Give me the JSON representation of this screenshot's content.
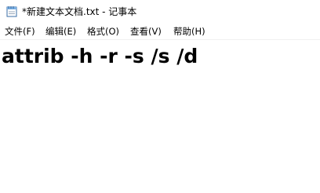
{
  "window": {
    "title": "*新建文本文档.txt - 记事本",
    "icon": "notepad-icon"
  },
  "menu": {
    "items": [
      {
        "label": "文件(F)"
      },
      {
        "label": "编辑(E)"
      },
      {
        "label": "格式(O)"
      },
      {
        "label": "查看(V)"
      },
      {
        "label": "帮助(H)"
      }
    ]
  },
  "editor": {
    "content": "attrib -h -r -s /s /d"
  }
}
